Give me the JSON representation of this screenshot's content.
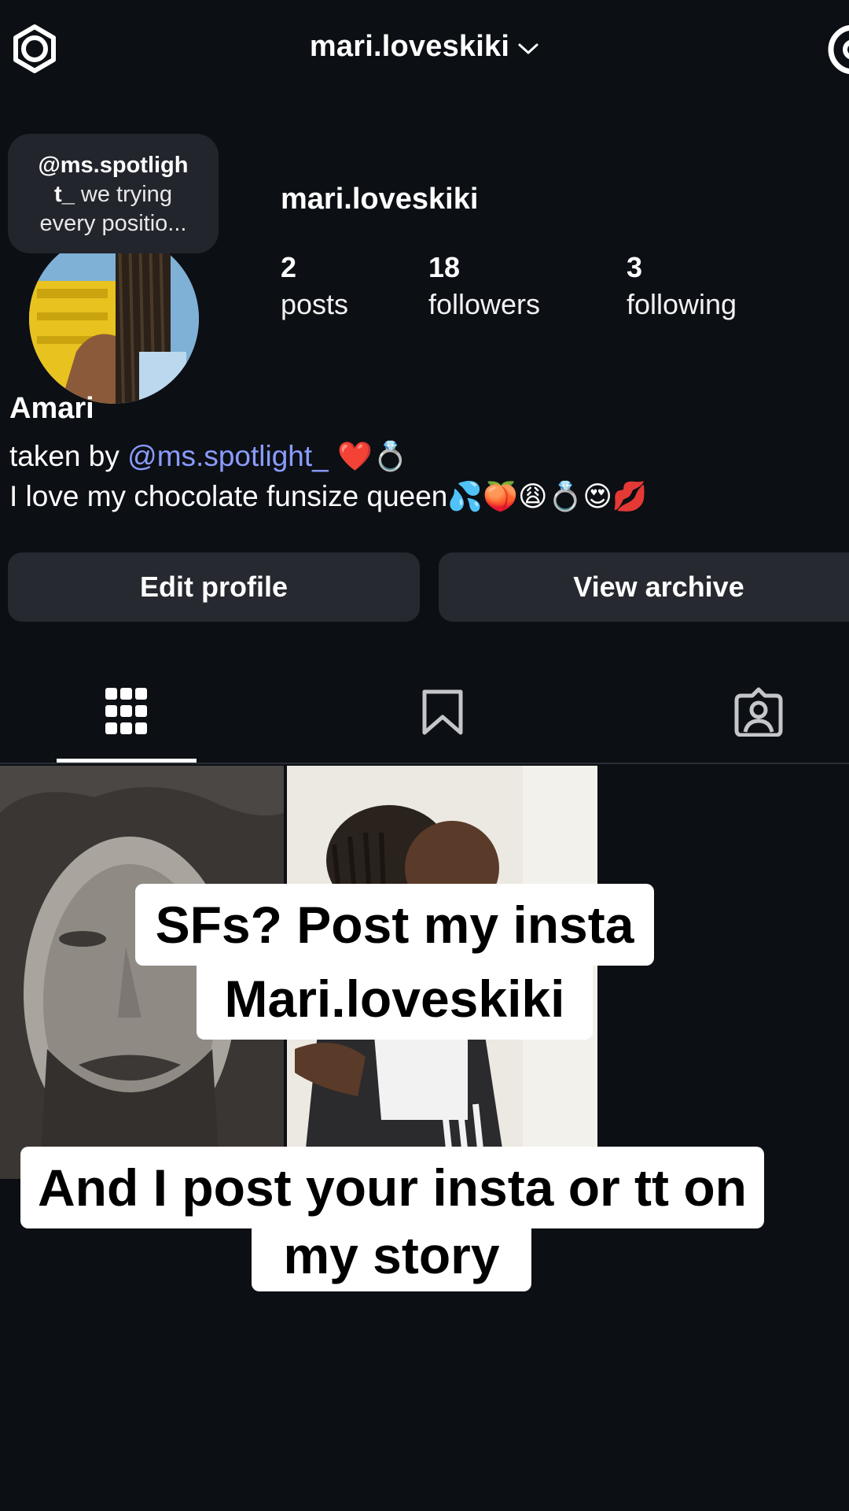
{
  "header": {
    "username": "mari.loveskiki",
    "icons": {
      "left": "gear-icon",
      "dropdown": "chevron-down-icon",
      "right": "threads-icon"
    }
  },
  "note": {
    "handle": "@ms.spotligh",
    "line2_handle": "t_",
    "line2_text": " we trying",
    "line3": "every positio..."
  },
  "profile": {
    "username": "mari.loveskiki",
    "stats": [
      {
        "value": "2",
        "label": "posts"
      },
      {
        "value": "18",
        "label": "followers"
      },
      {
        "value": "3",
        "label": "following"
      }
    ],
    "display_name": "Amari",
    "bio_line1_prefix": "taken by ",
    "bio_line1_mention": "@ms.spotlight_",
    "bio_line1_emoji": " ❤️💍",
    "bio_line2_text": "I love my chocolate funsize queen",
    "bio_line2_emoji": "💦🍑😩💍😍💋"
  },
  "buttons": {
    "edit": "Edit profile",
    "archive": "View archive"
  },
  "tabs": {
    "grid": "grid-icon",
    "saved": "bookmark-icon",
    "tagged": "tagged-person-icon",
    "active": "grid"
  },
  "overlay": {
    "line1": "SFs? Post my insta",
    "line2": "Mari.loveskiki",
    "line3": "And I post your insta or tt on",
    "line4": "my story"
  },
  "colors": {
    "background": "#0c0f14",
    "button": "#26292f",
    "mention": "#8a9cff"
  }
}
